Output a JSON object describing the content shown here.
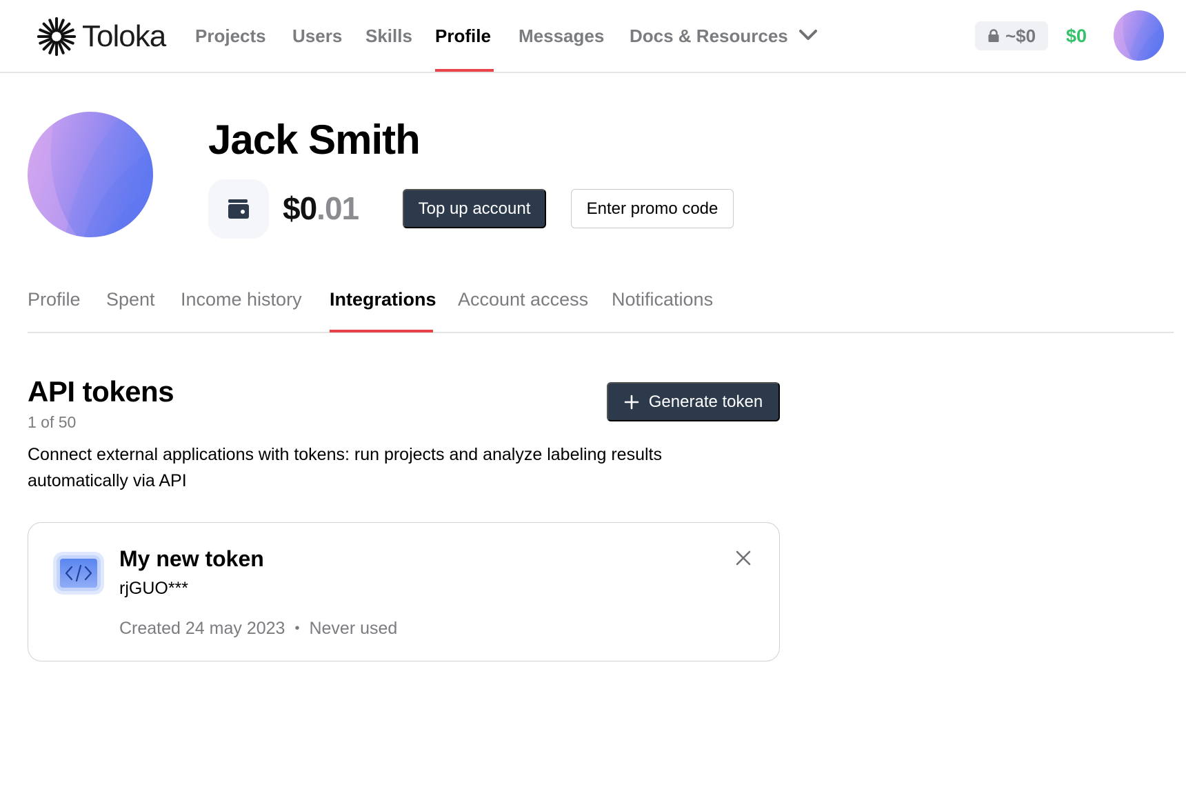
{
  "header": {
    "logo_text": "Toloka",
    "nav": [
      {
        "label": "Projects",
        "active": false
      },
      {
        "label": "Users",
        "active": false
      },
      {
        "label": "Skills",
        "active": false
      },
      {
        "label": "Profile",
        "active": true
      },
      {
        "label": "Messages",
        "active": false
      },
      {
        "label": "Docs & Resources",
        "active": false,
        "has_dropdown": true
      }
    ],
    "locked_balance": "~$0",
    "balance": "$0",
    "icons": {
      "lock": "lock-icon",
      "chevron": "chevron-down-icon",
      "avatar": "user-avatar"
    }
  },
  "profile": {
    "name": "Jack Smith",
    "balance_int": "$0",
    "balance_frac": ".01",
    "wallet_icon": "wallet-icon",
    "top_up_label": "Top up account",
    "promo_label": "Enter promo code"
  },
  "tabs": [
    {
      "label": "Profile",
      "active": false
    },
    {
      "label": "Spent",
      "active": false
    },
    {
      "label": "Income history",
      "active": false
    },
    {
      "label": "Integrations",
      "active": true
    },
    {
      "label": "Account access",
      "active": false
    },
    {
      "label": "Notifications",
      "active": false
    }
  ],
  "api_tokens": {
    "title": "API tokens",
    "count": "1 of 50",
    "description": "Connect external applications with tokens: run projects and analyze labeling results automatically via API",
    "generate_label": "Generate token",
    "tokens": [
      {
        "name": "My new token",
        "value": "rjGUO***",
        "created": "Created 24 may 2023",
        "separator": "•",
        "usage": "Never used",
        "icon": "code-icon"
      }
    ]
  },
  "colors": {
    "accent_red": "#e8434b",
    "dark_button": "#2d3a4c",
    "balance_green": "#33c26a",
    "muted_text": "#7a7c80"
  }
}
